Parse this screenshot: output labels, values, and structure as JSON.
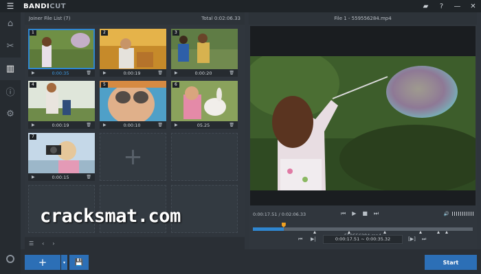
{
  "app": {
    "logo_main": "BANDI",
    "logo_accent": "CUT"
  },
  "titlebar": {
    "icons": [
      "folder-icon",
      "help-icon",
      "minimize-icon",
      "close-icon"
    ]
  },
  "rail": {
    "items": [
      "home-icon",
      "cut-icon",
      "joiner-icon",
      "info-icon",
      "settings-icon"
    ],
    "active": 2
  },
  "joiner": {
    "title": "Joiner File List (7)",
    "total": "Total 0:02:06.33",
    "clips": [
      {
        "num": "1",
        "duration": "0:00:35",
        "selected": true
      },
      {
        "num": "2",
        "duration": "0:00:19"
      },
      {
        "num": "3",
        "duration": "0:00:20"
      },
      {
        "num": "4",
        "duration": "0:00:19"
      },
      {
        "num": "5",
        "duration": "0:00:10"
      },
      {
        "num": "6",
        "duration": "05.25"
      },
      {
        "num": "7",
        "duration": "0:00:15"
      }
    ]
  },
  "player": {
    "title": "File 1 - 559556284.mp4",
    "time": "0:00:17.51 / 0:02:06.33",
    "filename": "559556284.mp4",
    "seek_range": "0:00:17.51 ~ 0:00:35.32",
    "progress": 0.14
  },
  "bottom": {
    "add_label": "+",
    "start_label": "Start"
  },
  "watermark": "cracksmat.com",
  "colors": {
    "accent": "#2c6fb6",
    "selected": "#2f86d0",
    "playhead": "#f0a020"
  }
}
